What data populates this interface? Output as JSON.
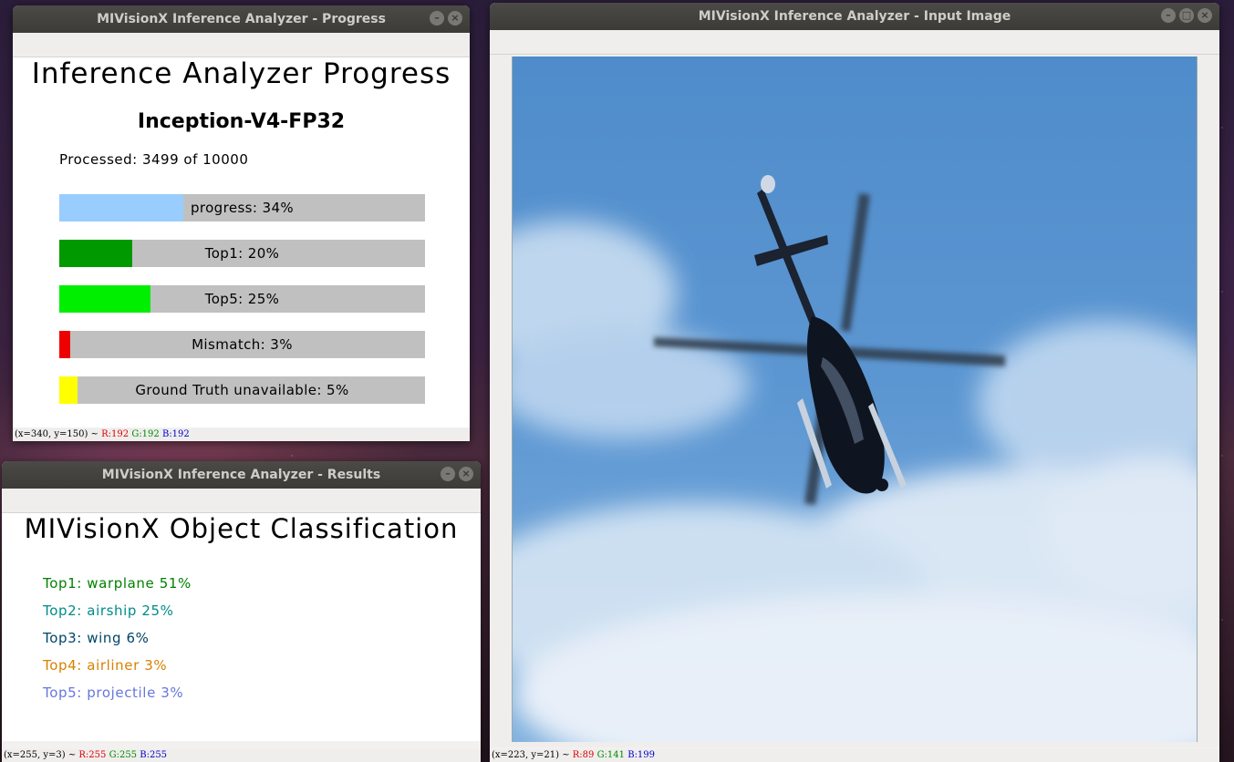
{
  "progress_window": {
    "title": "MIVisionX Inference Analyzer - Progress",
    "heading": "Inference Analyzer Progress",
    "model": "Inception-V4-FP32",
    "processed_text": "Processed: 3499 of 10000",
    "bars": [
      {
        "label": "progress: 34%",
        "fraction": 0.34,
        "color": "#99ccff"
      },
      {
        "label": "Top1: 20%",
        "fraction": 0.2,
        "color": "#009900"
      },
      {
        "label": "Top5: 25%",
        "fraction": 0.25,
        "color": "#00ee00"
      },
      {
        "label": "Mismatch: 3%",
        "fraction": 0.03,
        "color": "#ee0000"
      },
      {
        "label": "Ground Truth unavailable: 5%",
        "fraction": 0.05,
        "color": "#ffff00"
      }
    ],
    "status": {
      "coords": "(x=340, y=150) ~",
      "r": "R:192",
      "g": "G:192",
      "b": "B:192"
    }
  },
  "results_window": {
    "title": "MIVisionX Inference Analyzer - Results",
    "heading": "MIVisionX Object Classification",
    "results": [
      {
        "text": "Top1: warplane 51%",
        "color": "#008000"
      },
      {
        "text": "Top2: airship 25%",
        "color": "#008b8b"
      },
      {
        "text": "Top3: wing 6%",
        "color": "#004466"
      },
      {
        "text": "Top4: airliner 3%",
        "color": "#d98000"
      },
      {
        "text": "Top5: projectile 3%",
        "color": "#6677dd"
      }
    ],
    "status": {
      "coords": "(x=255, y=3) ~",
      "r": "R:255",
      "g": "G:255",
      "b": "B:255"
    }
  },
  "input_window": {
    "title": "MIVisionX Inference Analyzer - Input Image",
    "status": {
      "coords": "(x=223, y=21) ~",
      "r": "R:89",
      "g": "G:141",
      "b": "B:199"
    }
  }
}
